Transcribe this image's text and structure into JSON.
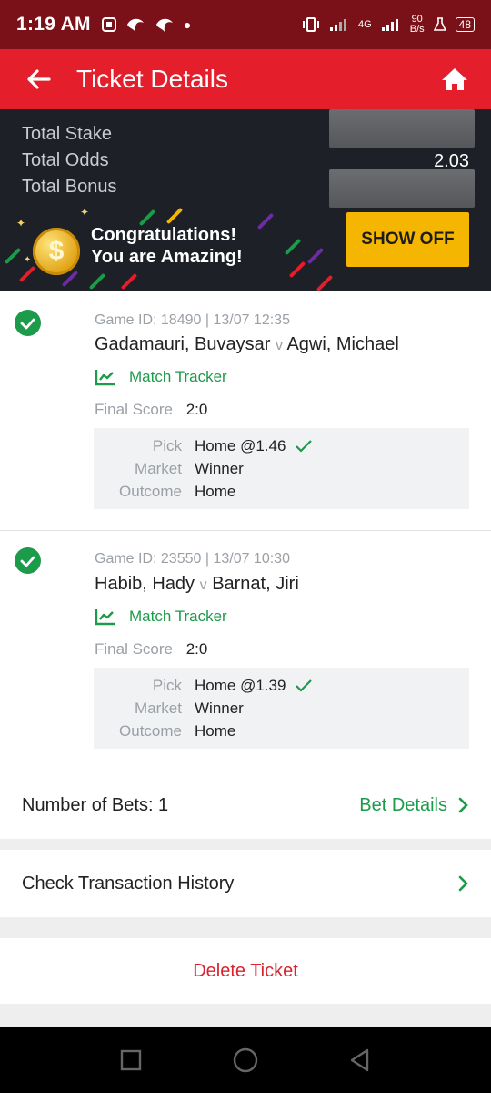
{
  "status_bar": {
    "time": "1:19 AM",
    "net_speed_top": "90",
    "net_speed_unit": "B/s",
    "network": "4G",
    "battery": "48"
  },
  "header": {
    "title": "Ticket Details"
  },
  "summary": {
    "stake_label": "Total Stake",
    "odds_label": "Total Odds",
    "odds_value": "2.03",
    "bonus_label": "Total Bonus",
    "congrats_line1": "Congratulations!",
    "congrats_line2": "You are Amazing!",
    "show_off_label": "SHOW OFF"
  },
  "bets": [
    {
      "game_meta": "Game ID: 18490 | 13/07 12:35",
      "home": "Gadamauri, Buvaysar",
      "vs": "v",
      "away": "Agwi, Michael",
      "tracker_label": "Match Tracker",
      "final_score_label": "Final Score",
      "final_score": "2:0",
      "pick_label": "Pick",
      "pick_value": "Home @1.46",
      "market_label": "Market",
      "market_value": "Winner",
      "outcome_label": "Outcome",
      "outcome_value": "Home"
    },
    {
      "game_meta": "Game ID: 23550 | 13/07 10:30",
      "home": "Habib, Hady",
      "vs": "v",
      "away": "Barnat, Jiri",
      "tracker_label": "Match Tracker",
      "final_score_label": "Final Score",
      "final_score": "2:0",
      "pick_label": "Pick",
      "pick_value": "Home @1.39",
      "market_label": "Market",
      "market_value": "Winner",
      "outcome_label": "Outcome",
      "outcome_value": "Home"
    }
  ],
  "footer": {
    "bets_count_label": "Number of Bets: 1",
    "bet_details_label": "Bet Details",
    "transaction_history_label": "Check Transaction History",
    "delete_label": "Delete Ticket"
  },
  "colors": {
    "brand_red": "#e41e2a",
    "status_bar": "#7a1118",
    "success_green": "#1c9b4a",
    "show_off_yellow": "#f5b602",
    "summary_bg": "#1d2127"
  }
}
